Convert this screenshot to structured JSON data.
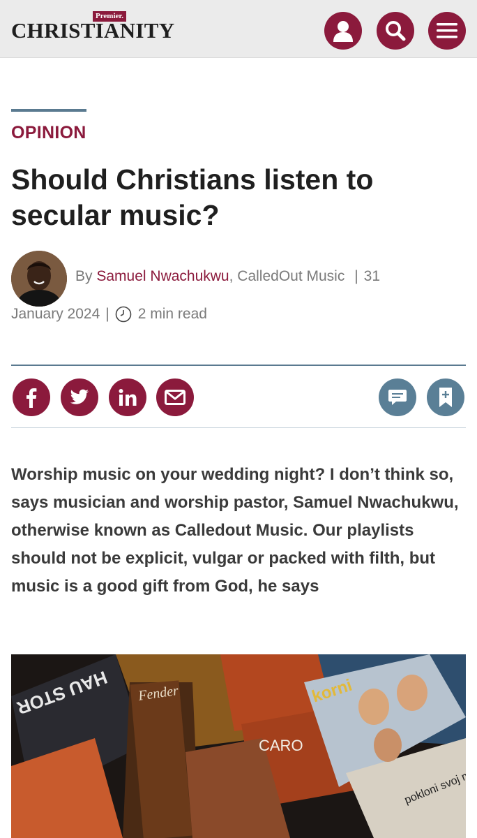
{
  "header": {
    "logo_premier": "Premier.",
    "logo_word": "CHRISTIANITY",
    "icons": [
      "user-icon",
      "search-icon",
      "menu-icon"
    ]
  },
  "article": {
    "category": "OPINION",
    "title": "Should Christians listen to secular music?",
    "by_prefix": "By",
    "author": "Samuel Nwachukwu",
    "org": ", CalledOut Music",
    "date_part1": "31",
    "date_part2": "January 2024",
    "read_time": "2 min read",
    "standfirst": "Worship music on your wedding night? I don’t think so, says musician and worship pastor, Samuel Nwachukwu, otherwise known as Calledout Music. Our playlists should not be explicit, vulgar or packed with filth, but music is a good gift from God, he says"
  },
  "share": {
    "icons": [
      "facebook-icon",
      "twitter-icon",
      "linkedin-icon",
      "email-icon",
      "comment-icon",
      "bookmark-icon"
    ]
  },
  "hero_image": {
    "record_texts": [
      "HAU STOR",
      "Fender",
      "CARO",
      "korni",
      "pokloni svoj mi"
    ]
  },
  "colors": {
    "brand": "#8b1a3c",
    "accent_blue": "#5a7f96",
    "header_bg": "#ebebeb"
  }
}
